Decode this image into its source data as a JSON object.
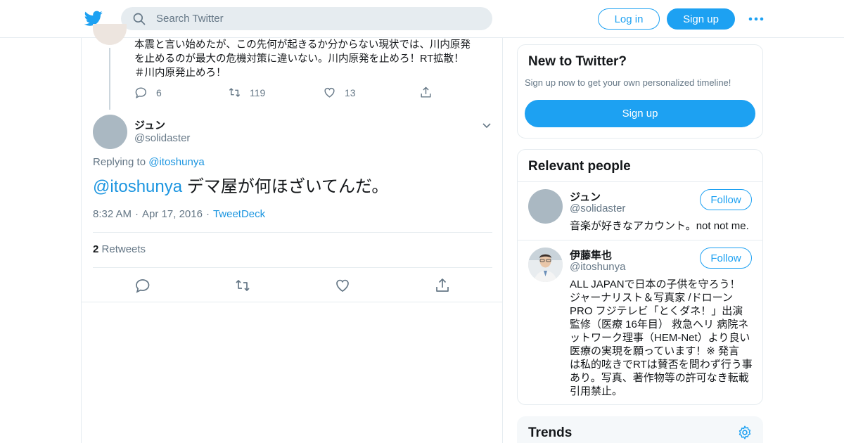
{
  "header": {
    "logo_icon": "twitter-bird-icon",
    "search_placeholder": "Search Twitter",
    "login_label": "Log in",
    "signup_label": "Sign up",
    "more_icon": "more-dots-icon"
  },
  "colors": {
    "brand": "#1da1f2",
    "link": "#1b95e0",
    "secondary_text": "#657786",
    "border": "#e6ecf0"
  },
  "previous_tweet": {
    "text_lines": [
      "本震と言い始めたが、この先何が起きるか分からない現状では、川内原発",
      "を止めるのが最大の危機対策に違いない。川内原発を止めろ！RT拡散！",
      "＃川内原発止めろ！"
    ],
    "replies": "6",
    "retweets": "119",
    "likes": "13"
  },
  "tweet": {
    "name": "ジュン",
    "handle": "@solidaster",
    "replying_to_prefix": "Replying to",
    "replying_to_handle": "@itoshunya",
    "mention": "@itoshunya",
    "text": " デマ屋が何ほざいてんだ。",
    "time": "8:32 AM",
    "date": "Apr 17, 2016",
    "source": "TweetDeck",
    "retweet_count": "2",
    "retweet_label": "Retweets"
  },
  "sidebar": {
    "new_to_twitter": {
      "title": "New to Twitter?",
      "subtitle": "Sign up now to get your own personalized timeline!",
      "button": "Sign up"
    },
    "relevant_people": {
      "title": "Relevant people",
      "people": [
        {
          "name": "ジュン",
          "handle": "@solidaster",
          "follow_label": "Follow",
          "bio_lines": [
            "音楽が好きなアカウント。not not me."
          ]
        },
        {
          "name": "伊藤隼也",
          "handle": "@itoshunya",
          "follow_label": "Follow",
          "bio_lines": [
            "ALL JAPANで日本の子供を守ろう！",
            "ジャーナリスト＆写真家 /ドローン",
            "PRO フジテレビ「とくダネ！」出演",
            "監修（医療 16年目） 救急ヘリ 病院ネ",
            "ットワーク理事（HEM-Net）より良い",
            "医療の実現を願っています！※ 発言",
            "は私的呟きでRTは賛否を問わず行う事",
            "あり。写真、著作物等の許可なき転載",
            "引用禁止。"
          ]
        }
      ]
    },
    "trends": {
      "title": "Trends",
      "settings_icon": "gear-icon"
    }
  }
}
